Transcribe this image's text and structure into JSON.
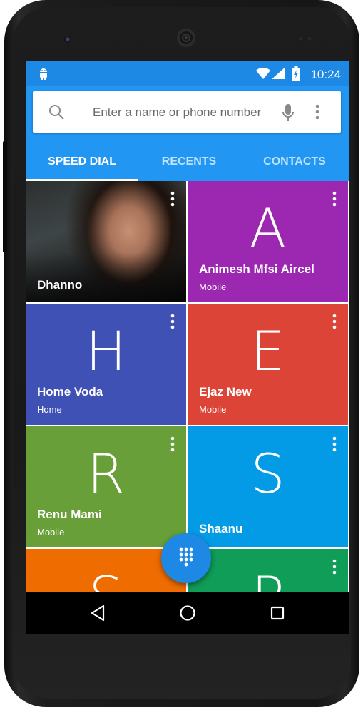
{
  "status_bar": {
    "time": "10:24",
    "icons": [
      "android-icon",
      "wifi-icon",
      "signal-icon",
      "battery-icon"
    ]
  },
  "search": {
    "placeholder": "Enter a name or phone number",
    "icons": [
      "search-icon",
      "mic-icon",
      "overflow-menu-icon"
    ]
  },
  "tabs": [
    {
      "label": "SPEED DIAL",
      "active": true
    },
    {
      "label": "RECENTS",
      "active": false
    },
    {
      "label": "CONTACTS",
      "active": false
    }
  ],
  "contacts": [
    {
      "name": "Dhanno",
      "type": "",
      "letter": "",
      "color": "#2b2b2b",
      "has_photo": true
    },
    {
      "name": "Animesh Mfsi Aircel",
      "type": "Mobile",
      "letter": "A",
      "color": "#9c27b0"
    },
    {
      "name": "Home Voda",
      "type": "Home",
      "letter": "H",
      "color": "#3f51b5"
    },
    {
      "name": "Ejaz New",
      "type": "Mobile",
      "letter": "E",
      "color": "#db4437"
    },
    {
      "name": "Renu Mami",
      "type": "Mobile",
      "letter": "R",
      "color": "#689f38"
    },
    {
      "name": "Shaanu",
      "type": "",
      "letter": "S",
      "color": "#039be5"
    },
    {
      "name": "",
      "type": "",
      "letter": "S",
      "color": "#ef6c00"
    },
    {
      "name": "",
      "type": "",
      "letter": "P",
      "color": "#0f9d58"
    }
  ],
  "fab": {
    "icon": "dialpad-icon"
  },
  "nav_bar": {
    "icons": [
      "back-icon",
      "home-icon",
      "recents-icon"
    ]
  },
  "colors": {
    "primary": "#2196f3",
    "status_bar": "#1e88e5",
    "fab": "#1e88e5"
  }
}
